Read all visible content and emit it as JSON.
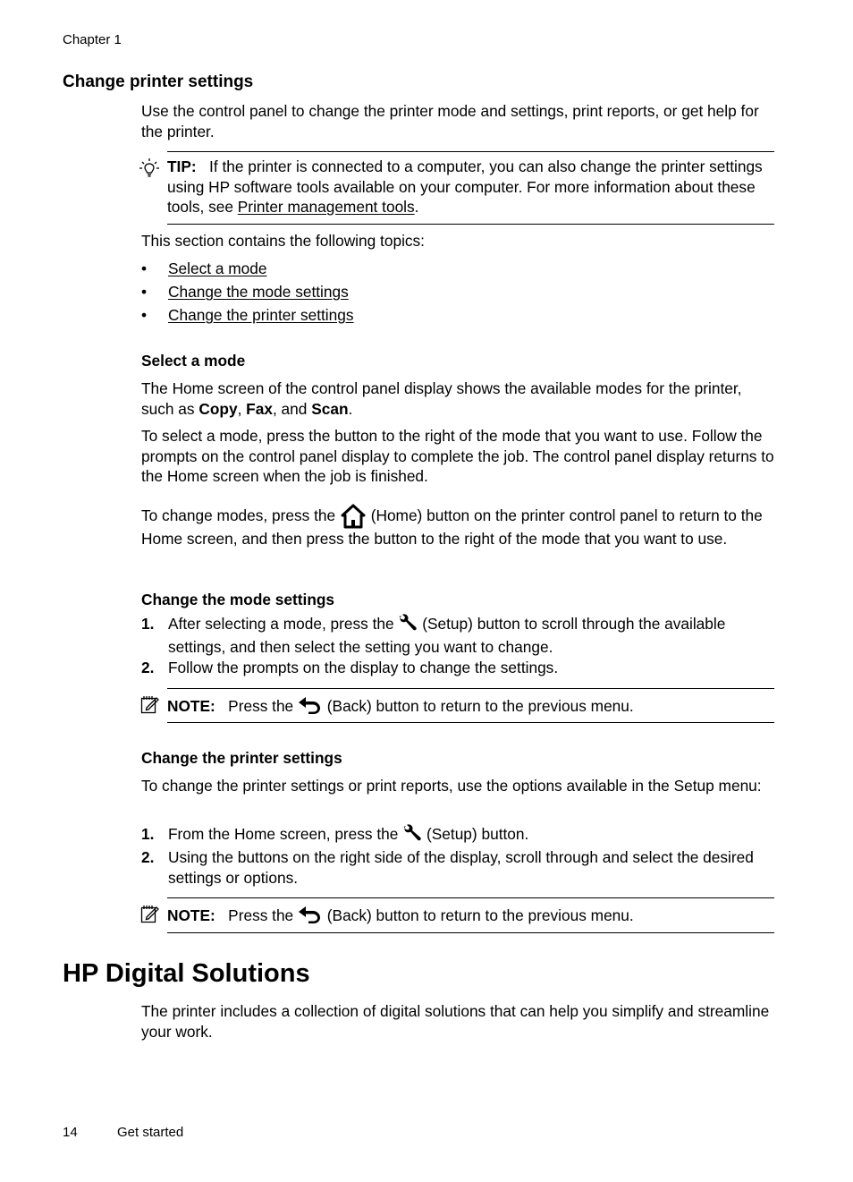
{
  "header": {
    "chapter": "Chapter 1"
  },
  "section": {
    "title": "Change printer settings",
    "intro": "Use the control panel to change the printer mode and settings, print reports, or get help for the printer.",
    "tip": {
      "icon": "lightbulb-icon",
      "label": "TIP:",
      "text_before": "If the printer is connected to a computer, you can also change the printer settings using HP software tools available on your computer. For more information about these tools, see ",
      "link": "Printer management tools",
      "text_after": "."
    },
    "topics_intro": "This section contains the following topics:",
    "topics": [
      {
        "bullet": "•",
        "label": "Select a mode"
      },
      {
        "bullet": "•",
        "label": "Change the mode settings"
      },
      {
        "bullet": "•",
        "label": "Change the printer settings"
      }
    ]
  },
  "select_mode": {
    "title": "Select a mode",
    "p1_before": "The Home screen of the control panel display shows the available modes for the printer, such as ",
    "p1_copy": "Copy",
    "p1_sep1": ", ",
    "p1_fax": "Fax",
    "p1_sep2": ", and ",
    "p1_scan": "Scan",
    "p1_end": ".",
    "p2": "To select a mode, press the button to the right of the mode that you want to use. Follow the prompts on the control panel display to complete the job. The control panel display returns to the Home screen when the job is finished.",
    "p3_before": "To change modes, press the ",
    "p3_icon": "home-icon",
    "p3_after": " (Home) button on the printer control panel to return to the Home screen, and then press the button to the right of the mode that you want to use."
  },
  "mode_settings": {
    "title": "Change the mode settings",
    "steps": [
      {
        "num": "1.",
        "before": "After selecting a mode, press the ",
        "icon": "wrench-icon",
        "after": " (Setup) button to scroll through the available settings, and then select the setting you want to change."
      },
      {
        "num": "2.",
        "text": "Follow the prompts on the display to change the settings."
      }
    ],
    "note": {
      "icon": "note-icon",
      "label": "NOTE:",
      "before": "Press the ",
      "icon2": "back-arrow-icon",
      "after": " (Back) button to return to the previous menu."
    }
  },
  "printer_settings": {
    "title": "Change the printer settings",
    "intro": "To change the printer settings or print reports, use the options available in the Setup menu:",
    "steps": [
      {
        "num": "1.",
        "before": "From the Home screen, press the ",
        "icon": "wrench-icon",
        "after": " (Setup) button."
      },
      {
        "num": "2.",
        "text": "Using the buttons on the right side of the display, scroll through and select the desired settings or options."
      }
    ],
    "note": {
      "icon": "note-icon",
      "label": "NOTE:",
      "before": "Press the ",
      "icon2": "back-arrow-icon",
      "after": " (Back) button to return to the previous menu."
    }
  },
  "digital": {
    "title": "HP Digital Solutions",
    "text": "The printer includes a collection of digital solutions that can help you simplify and streamline your work."
  },
  "footer": {
    "page_number": "14",
    "section": "Get started"
  }
}
